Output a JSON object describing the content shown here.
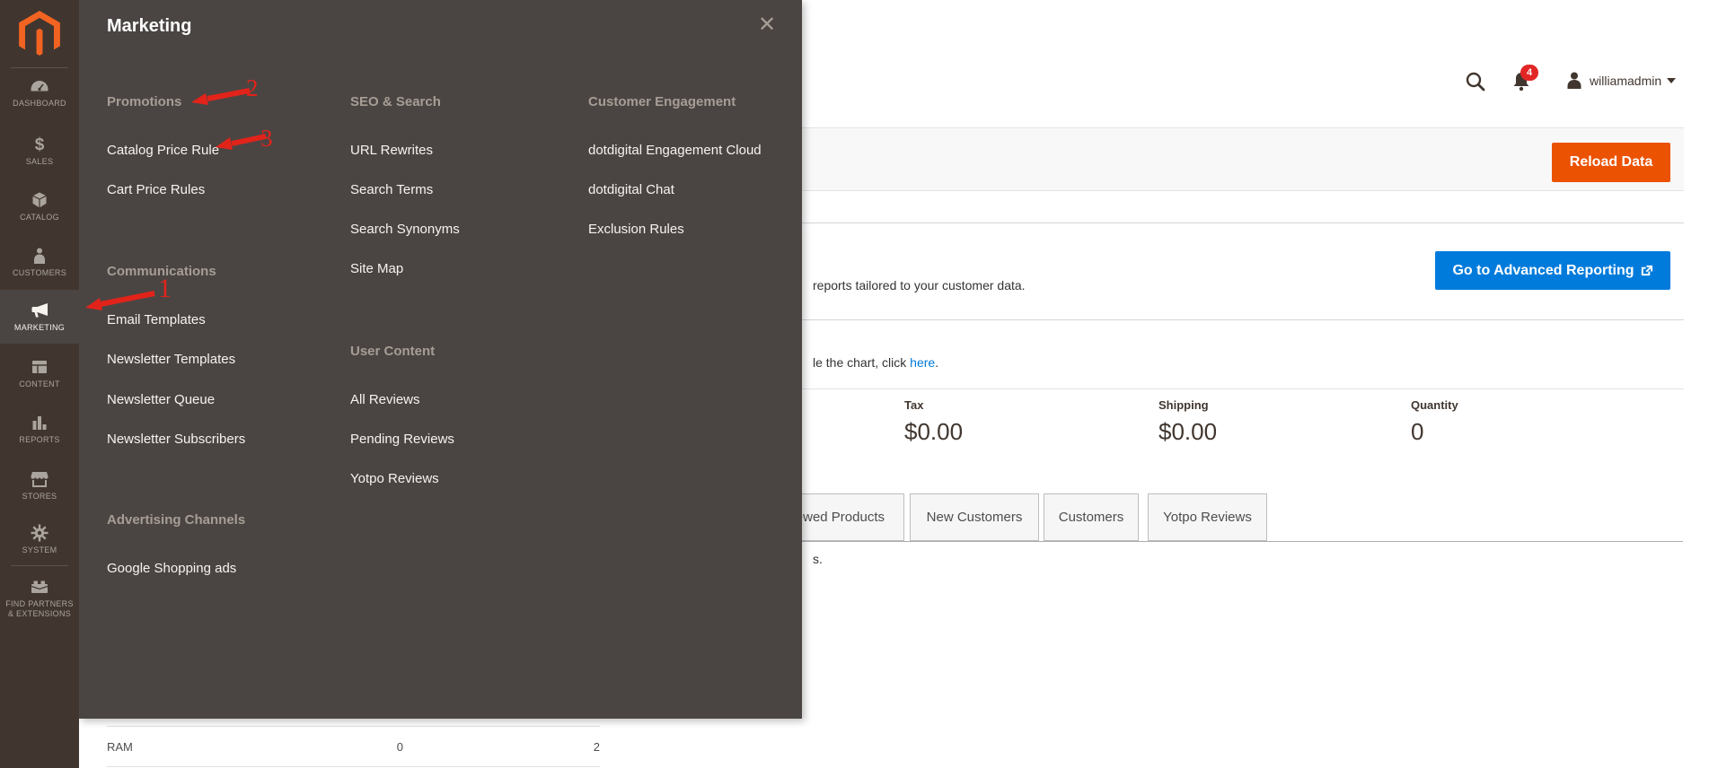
{
  "header": {
    "user": "williamadmin",
    "notification_count": "4"
  },
  "toolbar": {
    "reload_label": "Reload Data"
  },
  "banner": {
    "text_fragment": "reports tailored to your customer data.",
    "button_label": "Go to Advanced Reporting"
  },
  "chart_note": {
    "prefix": "le the chart, click ",
    "link": "here",
    "suffix": "."
  },
  "totals": [
    {
      "label": "Tax",
      "value": "$0.00"
    },
    {
      "label": "Shipping",
      "value": "$0.00"
    },
    {
      "label": "Quantity",
      "value": "0"
    }
  ],
  "tabs": [
    {
      "label": "ewed Products"
    },
    {
      "label": "New Customers"
    },
    {
      "label": "Customers"
    },
    {
      "label": "Yotpo Reviews"
    }
  ],
  "clipped_text": "s.",
  "bottom_table": {
    "name": "RAM",
    "col1": "0",
    "col2": "2"
  },
  "sidebar": {
    "items": [
      {
        "label": "DASHBOARD"
      },
      {
        "label": "SALES"
      },
      {
        "label": "CATALOG"
      },
      {
        "label": "CUSTOMERS"
      },
      {
        "label": "MARKETING"
      },
      {
        "label": "CONTENT"
      },
      {
        "label": "REPORTS"
      },
      {
        "label": "STORES"
      },
      {
        "label": "SYSTEM"
      },
      {
        "label": "FIND PARTNERS & EXTENSIONS"
      }
    ]
  },
  "flyout": {
    "title": "Marketing",
    "close_glyph": "✕",
    "columns": [
      {
        "sections": [
          {
            "header": "Promotions",
            "items": [
              "Catalog Price Rule",
              "Cart Price Rules"
            ]
          },
          {
            "header": "Communications",
            "items": [
              "Email Templates",
              "Newsletter Templates",
              "Newsletter Queue",
              "Newsletter Subscribers"
            ]
          },
          {
            "header": "Advertising Channels",
            "items": [
              "Google Shopping ads"
            ]
          }
        ]
      },
      {
        "sections": [
          {
            "header": "SEO & Search",
            "items": [
              "URL Rewrites",
              "Search Terms",
              "Search Synonyms",
              "Site Map"
            ]
          },
          {
            "header": "User Content",
            "items": [
              "All Reviews",
              "Pending Reviews",
              "Yotpo Reviews"
            ]
          }
        ]
      },
      {
        "sections": [
          {
            "header": "Customer Engagement",
            "items": [
              "dotdigital Engagement Cloud",
              "dotdigital Chat",
              "Exclusion Rules"
            ]
          }
        ]
      }
    ]
  },
  "annotations": [
    {
      "number": "1"
    },
    {
      "number": "2"
    },
    {
      "number": "3"
    }
  ],
  "colors": {
    "sidebar_bg": "#41362f",
    "flyout_bg": "#4a4543",
    "brand_orange": "#eb5202",
    "logo_orange": "#f26322",
    "action_blue": "#007bdb",
    "badge_red": "#e22626",
    "annotation_red": "#e2231a",
    "menu_header_gray": "#a79d95",
    "menu_item_text": "#f7f3ef",
    "heading_text": "#41362f"
  }
}
